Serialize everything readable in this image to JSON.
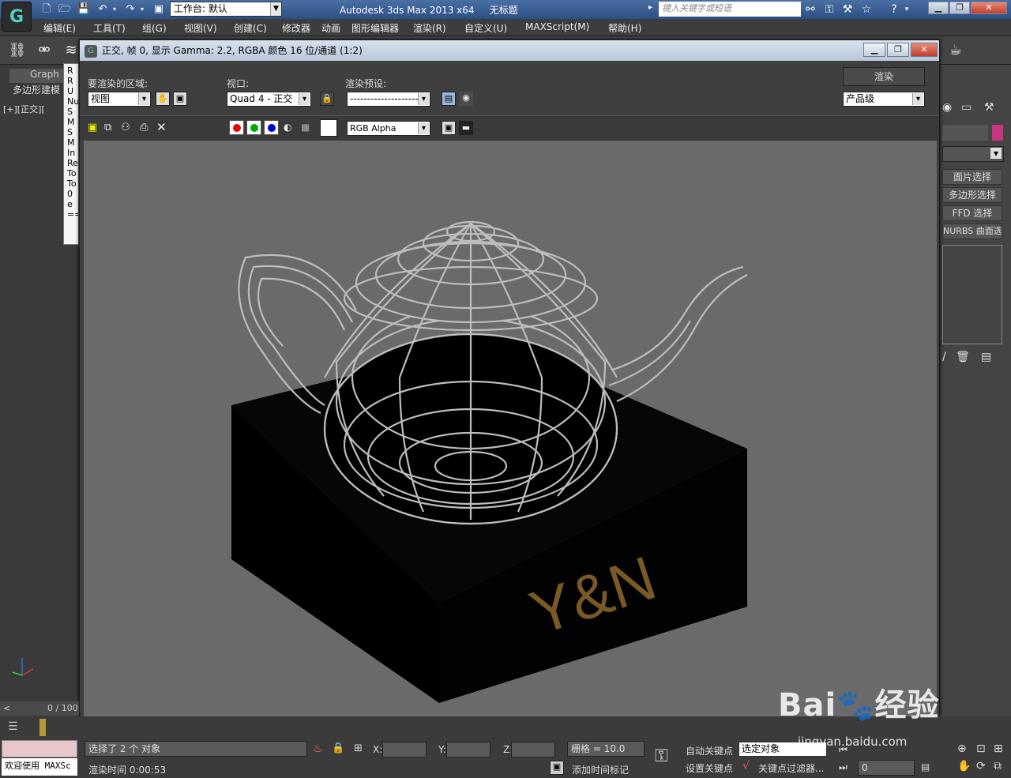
{
  "app": {
    "title": "Autodesk 3ds Max  2013 x64",
    "doc": "无标题",
    "workspace": "工作台: 默认",
    "search_placeholder": "键入关键字或短语"
  },
  "menu": [
    "编辑(E)",
    "工具(T)",
    "组(G)",
    "视图(V)",
    "创建(C)",
    "修改器",
    "动画",
    "图形编辑器",
    "渲染(R)",
    "自定义(U)",
    "MAXScript(M)",
    "帮助(H)"
  ],
  "left": {
    "graphite_tab": "Graph",
    "poly_tab": "多边形建模",
    "viewport_label": "[+][正交][",
    "list_lines": [
      "R",
      "R",
      "U",
      "Nu",
      "S",
      "M",
      "S",
      "M",
      "In",
      "Re",
      "To",
      "To",
      "0 e",
      "=="
    ],
    "time": "0 / 100"
  },
  "render_window": {
    "title": "正交, 帧 0, 显示 Gamma: 2.2, RGBA 颜色 16 位/通道 (1:2)",
    "area_label": "要渲染的区域:",
    "area_value": "视图",
    "viewport_label": "视口:",
    "viewport_value": "Quad 4 - 正交",
    "preset_label": "渲染预设:",
    "preset_value": "--------------------",
    "render_button": "渲染",
    "quality_value": "产品级",
    "channel_value": "RGB Alpha",
    "scene_text": "Y&N"
  },
  "right_panel": {
    "buttons": [
      "面片选择",
      "多边形选择",
      "FFD 选择",
      "NURBS 曲面选择"
    ]
  },
  "status": {
    "selected": "选择了 2 个 对象",
    "render_time": "渲染时间  0:00:53",
    "welcome": "欢迎使用 MAXSc",
    "x_label": "X:",
    "y_label": "Y:",
    "z_label": "Z:",
    "grid": "栅格 = 10.0",
    "auto_key": "自动关键点",
    "set_key": "设置关键点",
    "selected_objects": "选定对象",
    "key_filter": "关键点过滤器...",
    "add_time_tag": "添加时间标记",
    "frame": "0"
  },
  "watermark": {
    "brand": "Bai",
    "brand2": "经验",
    "url": "jingyan.baidu.com"
  }
}
